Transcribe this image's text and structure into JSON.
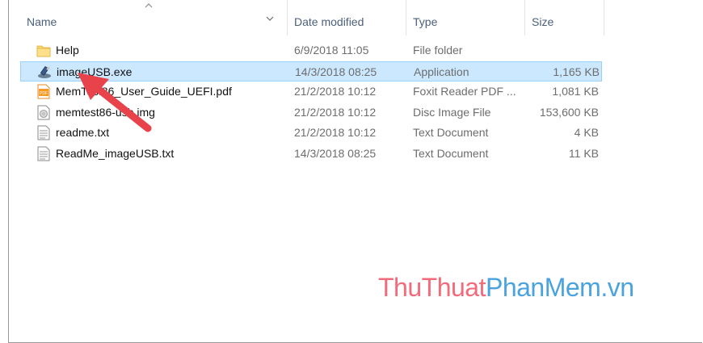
{
  "columns": {
    "name": "Name",
    "date": "Date modified",
    "type": "Type",
    "size": "Size"
  },
  "files": [
    {
      "name": "Help",
      "date": "6/9/2018 11:05",
      "type": "File folder",
      "size": "",
      "icon": "folder-icon"
    },
    {
      "name": "imageUSB.exe",
      "date": "14/3/2018 08:25",
      "type": "Application",
      "size": "1,165 KB",
      "icon": "application-icon",
      "selected": true
    },
    {
      "name": "MemTest86_User_Guide_UEFI.pdf",
      "date": "21/2/2018 10:12",
      "type": "Foxit Reader PDF ...",
      "size": "1,081 KB",
      "icon": "pdf-icon"
    },
    {
      "name": "memtest86-usb.img",
      "date": "21/2/2018 10:12",
      "type": "Disc Image File",
      "size": "153,600 KB",
      "icon": "disc-image-icon"
    },
    {
      "name": "readme.txt",
      "date": "21/2/2018 10:12",
      "type": "Text Document",
      "size": "4 KB",
      "icon": "text-file-icon"
    },
    {
      "name": "ReadMe_imageUSB.txt",
      "date": "14/3/2018 08:25",
      "type": "Text Document",
      "size": "11 KB",
      "icon": "text-file-icon"
    }
  ],
  "watermark": {
    "part1": "ThuThuat",
    "part2": "PhanMem.vn"
  },
  "colors": {
    "selection_bg": "#cce8ff",
    "selection_border": "#99d1ff",
    "arrow": "#e8424a",
    "watermark_red": "#f26b7a",
    "watermark_blue": "#4aa3df"
  }
}
